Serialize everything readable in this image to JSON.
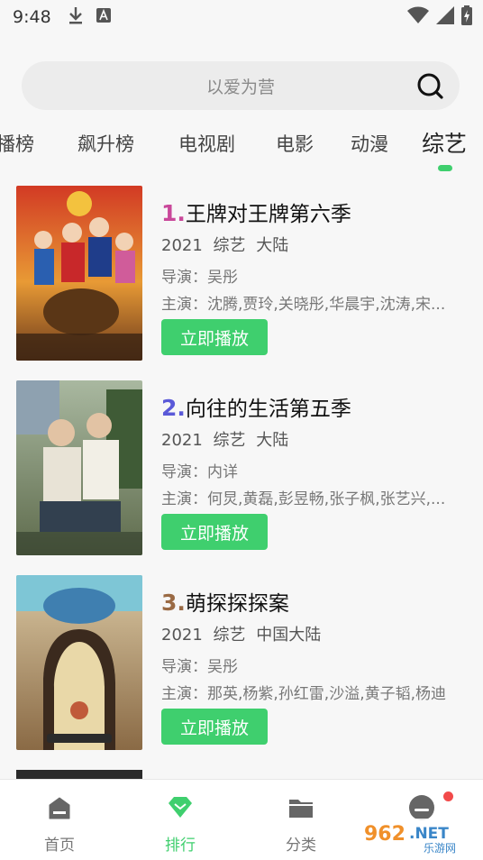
{
  "status_bar": {
    "time": "9:48"
  },
  "search": {
    "placeholder": "以爱为营"
  },
  "tabs": [
    {
      "label": "播榜"
    },
    {
      "label": "飙升榜"
    },
    {
      "label": "电视剧"
    },
    {
      "label": "电影"
    },
    {
      "label": "动漫"
    },
    {
      "label": "综艺",
      "active": true
    }
  ],
  "items": [
    {
      "rank": "1.",
      "title": "王牌对王牌第六季",
      "year": "2021",
      "genre": "综艺",
      "region": "大陆",
      "director": "导演：吴彤",
      "cast": "主演：沈腾,贾玲,关晓彤,华晨宇,沈涛,宋...",
      "button": "立即播放",
      "rank_color": "#c9489a"
    },
    {
      "rank": "2.",
      "title": "向往的生活第五季",
      "year": "2021",
      "genre": "综艺",
      "region": "大陆",
      "director": "导演：内详",
      "cast": "主演：何炅,黄磊,彭昱畅,张子枫,张艺兴,...",
      "button": "立即播放",
      "rank_color": "#5a59d8"
    },
    {
      "rank": "3.",
      "title": "萌探探探案",
      "year": "2021",
      "genre": "综艺",
      "region": "中国大陆",
      "director": "导演：吴彤",
      "cast": "主演：那英,杨紫,孙红雷,沙溢,黄子韬,杨迪",
      "button": "立即播放",
      "rank_color": "#9a6a44"
    }
  ],
  "bottom_nav": [
    {
      "label": "首页",
      "icon": "home-icon"
    },
    {
      "label": "排行",
      "icon": "ranking-diamond-icon",
      "active": true
    },
    {
      "label": "分类",
      "icon": "folder-icon"
    },
    {
      "label": "",
      "icon": "profile-icon"
    }
  ],
  "watermark": {
    "text": "962.NET",
    "subtext": "乐游网"
  },
  "colors": {
    "accent": "#3fcf6e",
    "notification": "#f24a4a"
  }
}
